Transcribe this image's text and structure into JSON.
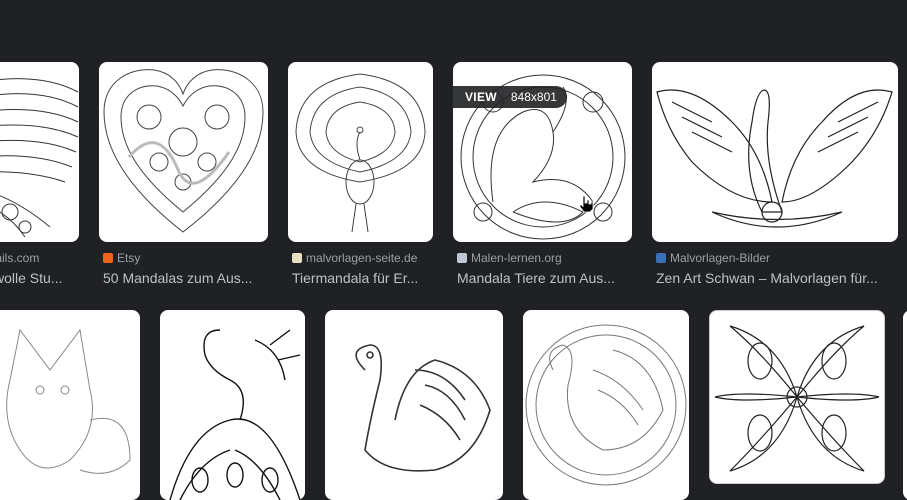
{
  "row1": [
    {
      "source": "tails.com",
      "title": "wolle Stu...",
      "favicon_color": "#5f6368"
    },
    {
      "source": "Etsy",
      "title": "50 Mandalas zum Aus...",
      "favicon_color": "#f1641e"
    },
    {
      "source": "malvorlagen-seite.de",
      "title": "Tiermandala für Er...",
      "favicon_color": "#e8e0c0"
    },
    {
      "source": "Malen-lernen.org",
      "title": "Mandala Tiere zum Aus...",
      "favicon_color": "#c0c8d8"
    },
    {
      "source": "Malvorlagen-Bilder",
      "title": "Zen Art Schwan – Malvorlagen für...",
      "favicon_color": "#3b6fb6"
    }
  ],
  "hover": {
    "view_label": "VIEW",
    "dimensions": "848x801"
  },
  "row2_labels": [
    "fox-image",
    "peacock-image",
    "swan-image",
    "swan-mandala-image",
    "swan-pattern-image"
  ],
  "colors": {
    "background": "#202124",
    "source_text": "#9aa0a6",
    "title_text": "#bdc1c6"
  }
}
